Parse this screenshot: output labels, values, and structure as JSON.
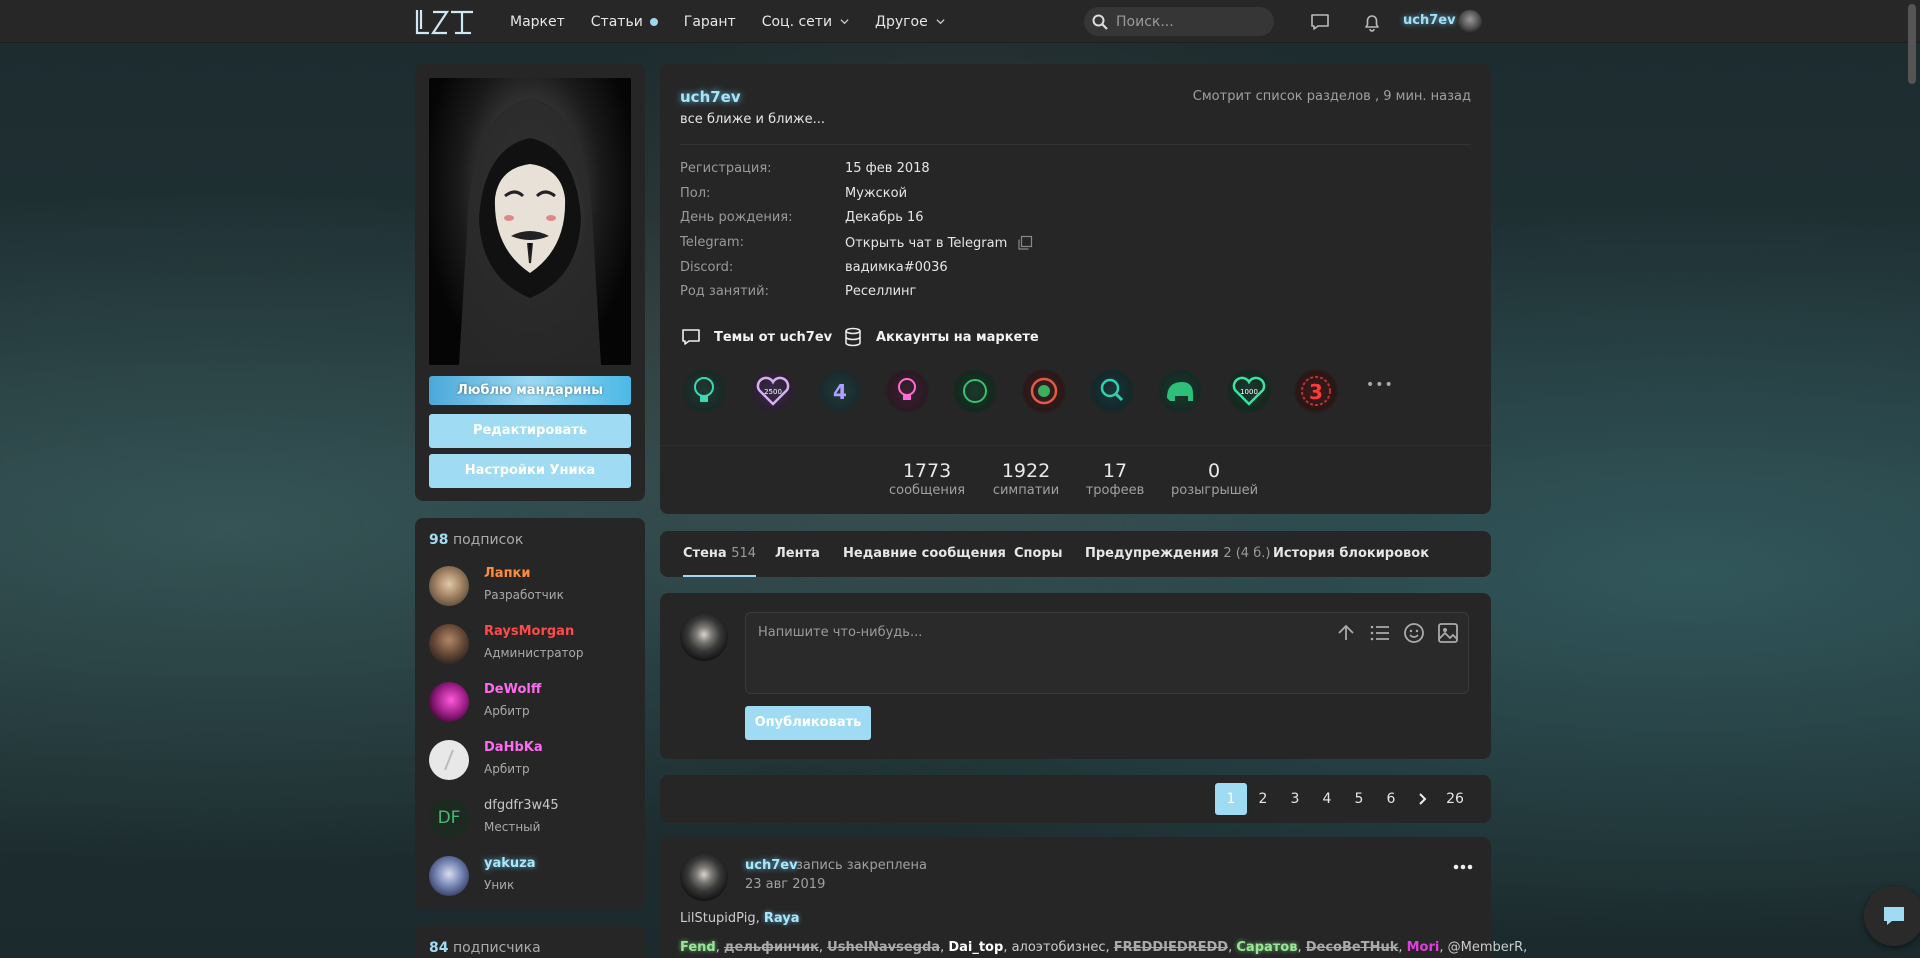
{
  "topbar": {
    "logo_text": "LZT",
    "nav": [
      {
        "label": "Маркет"
      },
      {
        "label": "Статьи"
      },
      {
        "label": "Гарант"
      },
      {
        "label": "Соц. сети"
      },
      {
        "label": "Другое"
      }
    ],
    "search_placeholder": "Поиск...",
    "username": "uch7ev"
  },
  "left": {
    "buttons": {
      "mandarin": "Люблю мандарины",
      "edit": "Редактировать",
      "unique_settings": "Настройки Уника"
    },
    "subscriptions": {
      "count": "98",
      "label": "подписок",
      "items": [
        {
          "name": "Лапки",
          "role": "Разработчик",
          "color": "#ff8c3a"
        },
        {
          "name": "RaysMorgan",
          "role": "Администратор",
          "color": "#ff4a4a"
        },
        {
          "name": "DeWolff",
          "role": "Арбитр",
          "color": "#ff6bf0"
        },
        {
          "name": "DaHbKa",
          "role": "Арбитр",
          "color": "#ff6bf0"
        },
        {
          "name": "dfgdfr3w45",
          "role": "Местный",
          "color": "#c8c8c8",
          "initials": "DF"
        },
        {
          "name": "yakuza",
          "role": "Уник",
          "color": "#a8e6f8"
        }
      ]
    },
    "subscribers": {
      "count": "84",
      "label": "подписчика"
    }
  },
  "profile": {
    "username": "uch7ev",
    "status": "все ближе и ближе...",
    "activity": "Смотрит список разделов , 9 мин. назад",
    "info": [
      {
        "label": "Регистрация:",
        "value": "15 фев 2018"
      },
      {
        "label": "Пол:",
        "value": "Мужской"
      },
      {
        "label": "День рождения:",
        "value": "Декабрь 16"
      },
      {
        "label": "Telegram:",
        "value": "Открыть чат в Telegram"
      },
      {
        "label": "Discord:",
        "value": "вадимка#0036"
      },
      {
        "label": "Род занятий:",
        "value": "Реселлинг"
      }
    ],
    "links": {
      "topics": "Темы от uch7ev",
      "market": "Аккаунты на маркете"
    },
    "trophy_more": "•••",
    "stats": [
      {
        "value": "1773",
        "label": "сообщения"
      },
      {
        "value": "1922",
        "label": "симпатии"
      },
      {
        "value": "17",
        "label": "трофеев"
      },
      {
        "value": "0",
        "label": "розыгрышей"
      }
    ]
  },
  "tabs": [
    {
      "label": "Стена",
      "count": "514"
    },
    {
      "label": "Лента",
      "count": ""
    },
    {
      "label": "Недавние сообщения",
      "count": ""
    },
    {
      "label": "Споры",
      "count": ""
    },
    {
      "label": "Предупреждения",
      "count": "2 (4 б.)"
    },
    {
      "label": "История блокировок",
      "count": ""
    }
  ],
  "composer": {
    "placeholder": "Напишите что-нибудь...",
    "publish": "Опубликовать"
  },
  "pagination": {
    "pages": [
      "1",
      "2",
      "3",
      "4",
      "5",
      "6"
    ],
    "last": "26",
    "current": "1"
  },
  "post": {
    "author": "uch7ev",
    "pinned": "запись закреплена",
    "date": "23 авг 2019",
    "line1_a": "LilStupidPig",
    "line1_sep": ", ",
    "line1_b": "Raya",
    "line2": [
      {
        "t": "Fend",
        "c": "#9be59b"
      },
      {
        "t": ", ",
        "c": "#ccc"
      },
      {
        "t": "дельфинчик",
        "c": "#aaa",
        "strike": true
      },
      {
        "t": ", ",
        "c": "#ccc"
      },
      {
        "t": "UshelNavsegda",
        "c": "#aaa",
        "strike": true
      },
      {
        "t": ", ",
        "c": "#ccc"
      },
      {
        "t": "Dai_top",
        "c": "#fff"
      },
      {
        "t": ", алоэтобизнес, ",
        "c": "#ccc"
      },
      {
        "t": "FREDDIEDREDD",
        "c": "#aaa",
        "strike": true
      },
      {
        "t": ", ",
        "c": "#ccc"
      },
      {
        "t": "Саратов",
        "c": "#9be59b"
      },
      {
        "t": ", ",
        "c": "#ccc"
      },
      {
        "t": "DecoBeTHuk",
        "c": "#aaa",
        "strike": true
      },
      {
        "t": ", ",
        "c": "#ccc"
      },
      {
        "t": "Mori",
        "c": "#e03ee0"
      },
      {
        "t": ", @MemberR,",
        "c": "#ccc"
      }
    ]
  }
}
